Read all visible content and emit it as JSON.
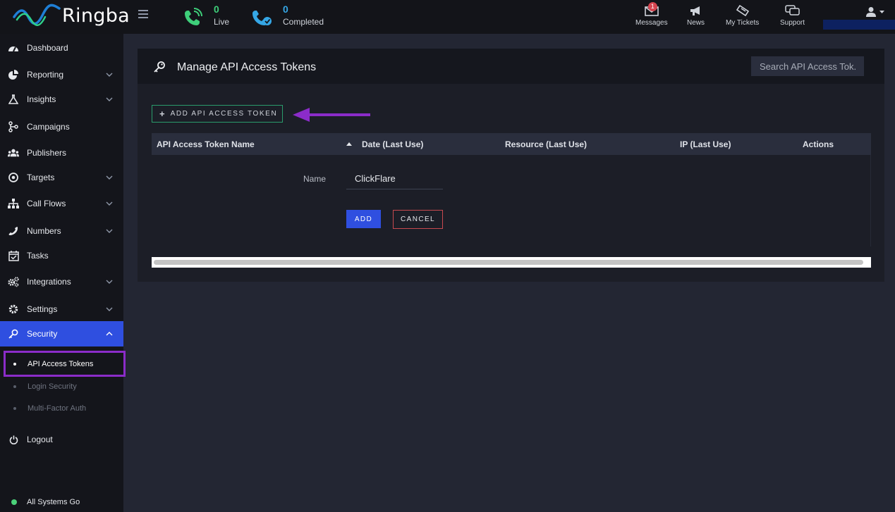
{
  "app": {
    "brand": "Ringba"
  },
  "header": {
    "live": {
      "count": "0",
      "label": "Live",
      "color": "#3ecf7a"
    },
    "completed": {
      "count": "0",
      "label": "Completed",
      "color": "#35a7e6"
    },
    "nav": [
      {
        "label": "Messages",
        "icon": "envelope-icon",
        "badge": "1"
      },
      {
        "label": "News",
        "icon": "megaphone-icon"
      },
      {
        "label": "My Tickets",
        "icon": "ticket-icon"
      },
      {
        "label": "Support",
        "icon": "chat-bubbles-icon"
      }
    ],
    "user_icon": "user-icon"
  },
  "sidebar": {
    "items": [
      {
        "label": "Dashboard",
        "icon": "gauge-icon"
      },
      {
        "label": "Reporting",
        "icon": "pie-chart-icon",
        "expandable": true
      },
      {
        "label": "Insights",
        "icon": "flask-icon",
        "expandable": true
      },
      {
        "label": "Campaigns",
        "icon": "branch-icon"
      },
      {
        "label": "Publishers",
        "icon": "users-icon"
      },
      {
        "label": "Targets",
        "icon": "target-icon",
        "expandable": true
      },
      {
        "label": "Call Flows",
        "icon": "sitemap-icon",
        "expandable": true
      },
      {
        "label": "Numbers",
        "icon": "phone-icon",
        "expandable": true
      },
      {
        "label": "Tasks",
        "icon": "calendar-check-icon"
      },
      {
        "label": "Integrations",
        "icon": "cogs-icon",
        "expandable": true
      },
      {
        "label": "Settings",
        "icon": "gear-icon",
        "expandable": true
      },
      {
        "label": "Security",
        "icon": "key-icon",
        "expandable": true,
        "active": true
      }
    ],
    "security_sub": [
      {
        "label": "API Access Tokens",
        "current": true
      },
      {
        "label": "Login Security"
      },
      {
        "label": "Multi-Factor Auth"
      }
    ],
    "logout": {
      "label": "Logout",
      "icon": "power-icon"
    },
    "status": {
      "label": "All Systems Go",
      "color": "#4bd27a"
    }
  },
  "main": {
    "title": "Manage API Access Tokens",
    "search_placeholder": "Search API Access Tok...",
    "add_button": "ADD API ACCESS TOKEN",
    "table": {
      "columns": [
        "API Access Token Name",
        "Date (Last Use)",
        "Resource (Last Use)",
        "IP (Last Use)",
        "Actions"
      ],
      "sort_column": "API Access Token Name",
      "sort_dir": "asc"
    },
    "form": {
      "name_label": "Name",
      "name_value": "ClickFlare",
      "add_label": "ADD",
      "cancel_label": "CANCEL"
    }
  },
  "annotation": {
    "color": "#8b2cc9"
  }
}
